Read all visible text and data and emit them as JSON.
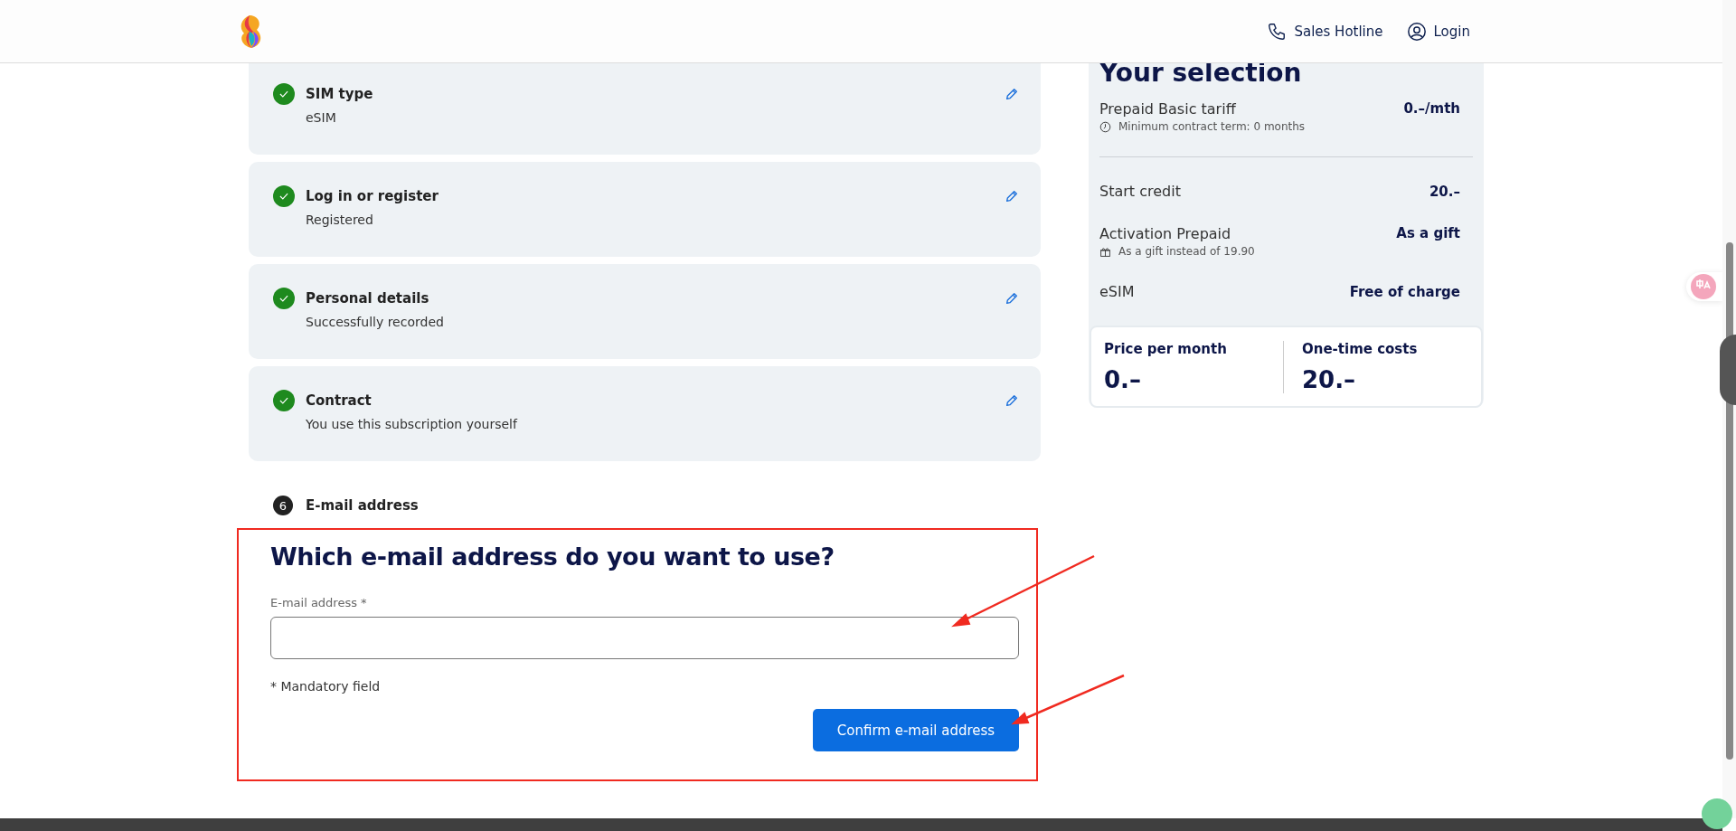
{
  "header": {
    "links": [
      {
        "kind": "phone",
        "label": "Sales Hotline"
      },
      {
        "kind": "user",
        "label": "Login"
      }
    ]
  },
  "steps": [
    {
      "title": "SIM type",
      "value": "eSIM",
      "done": true
    },
    {
      "title": "Log in or register",
      "value": "Registered",
      "done": true
    },
    {
      "title": "Personal details",
      "value": "Successfully recorded",
      "done": true
    },
    {
      "title": "Contract",
      "value": "You use this subscription yourself",
      "done": true
    }
  ],
  "current_step": {
    "number": "6",
    "title": "E-mail address"
  },
  "form": {
    "heading": "Which e-mail address do you want to use?",
    "field_label": "E-mail address",
    "required_mark": "*",
    "mandatory_note": "* Mandatory field",
    "button": "Confirm e-mail address"
  },
  "selection": {
    "title": "Your selection",
    "items": [
      {
        "label": "Prepaid Basic tariff",
        "value": "0.–/mth",
        "note": "Minimum contract term: 0 months",
        "kind": "term",
        "divider_after": true
      },
      {
        "label": "Start credit",
        "value": "20.–",
        "kind": "plain",
        "divider_after": false
      },
      {
        "label": "Activation Prepaid",
        "value": "As a gift",
        "note": "As a gift instead of 19.90",
        "kind": "gift",
        "divider_after": false
      },
      {
        "label": "eSIM",
        "value": "Free of charge",
        "kind": "plain",
        "divider_after": false
      }
    ],
    "totals": [
      {
        "label": "Price per month",
        "value": "0.–"
      },
      {
        "label": "One-time costs",
        "value": "20.–"
      }
    ]
  }
}
